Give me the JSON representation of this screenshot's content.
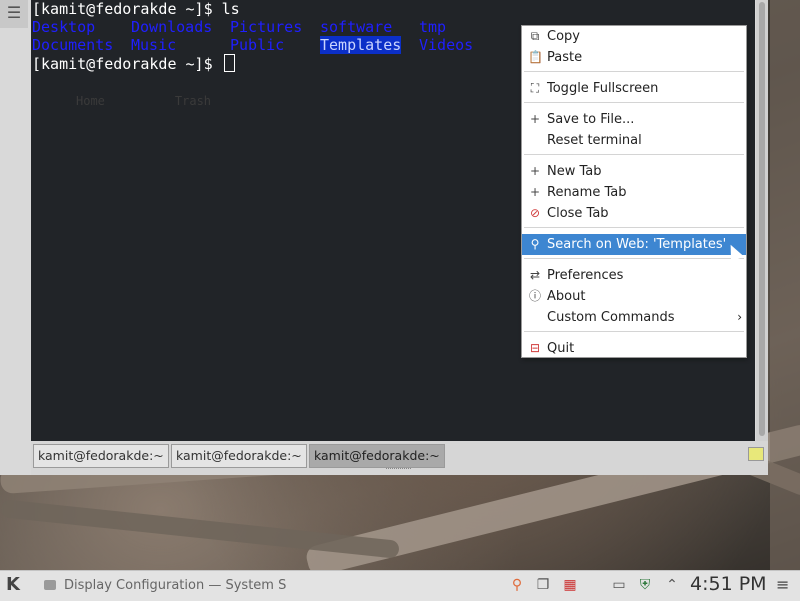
{
  "terminal": {
    "menu_glyph": "☰",
    "line1": "[kamit@fedorakde ~]$ ls",
    "dirs_row1": [
      "Desktop",
      "Downloads",
      "Pictures",
      "software",
      "tmp"
    ],
    "dirs_row2": [
      "Documents",
      "Music",
      "Public",
      "Templates",
      "Videos"
    ],
    "prompt": "[kamit@fedorakde ~]$ ",
    "desktop_icons": [
      "Home",
      "Trash"
    ],
    "tabs": [
      "kamit@fedorakde:~",
      "kamit@fedorakde:~",
      "kamit@fedorakde:~"
    ],
    "active_tab_index": 2
  },
  "context_menu": {
    "items": [
      {
        "label": "Copy",
        "icon": "copy-icon",
        "glyph": "⧉"
      },
      {
        "label": "Paste",
        "icon": "paste-icon",
        "glyph": "📋"
      },
      {
        "label": "Toggle Fullscreen",
        "icon": "fullscreen-icon",
        "glyph": "⛶"
      },
      {
        "label": "Save to File...",
        "icon": "plus-icon",
        "glyph": "+"
      },
      {
        "label": "Reset terminal",
        "icon": "",
        "glyph": ""
      },
      {
        "label": "New Tab",
        "icon": "plus-icon",
        "glyph": "+"
      },
      {
        "label": "Rename Tab",
        "icon": "plus-icon",
        "glyph": "+"
      },
      {
        "label": "Close Tab",
        "icon": "close-circle-icon",
        "glyph": "⃠"
      },
      {
        "label": "Search on Web: 'Templates'",
        "icon": "search-icon",
        "glyph": "🔍"
      },
      {
        "label": "Preferences",
        "icon": "preferences-icon",
        "glyph": "⇄"
      },
      {
        "label": "About",
        "icon": "info-icon",
        "glyph": "ⓘ"
      },
      {
        "label": "Custom Commands",
        "icon": "",
        "glyph": "",
        "submenu": "›"
      },
      {
        "label": "Quit",
        "icon": "quit-icon",
        "glyph": "⊟"
      }
    ],
    "highlighted": "Search on Web: 'Templates'"
  },
  "taskbar": {
    "launcher_glyph": "K",
    "task_title": "Display Configuration  — System S",
    "clock": "4:51 PM",
    "menu_glyph": "≡",
    "tray_glyphs": {
      "user": "⚲",
      "clipboard": "❐",
      "battery": "▦",
      "display": "▭",
      "shield": "⛨",
      "expand": "⌃"
    },
    "colors": {
      "accent": "#3d86d1",
      "dir_blue": "#1f1fff"
    }
  }
}
